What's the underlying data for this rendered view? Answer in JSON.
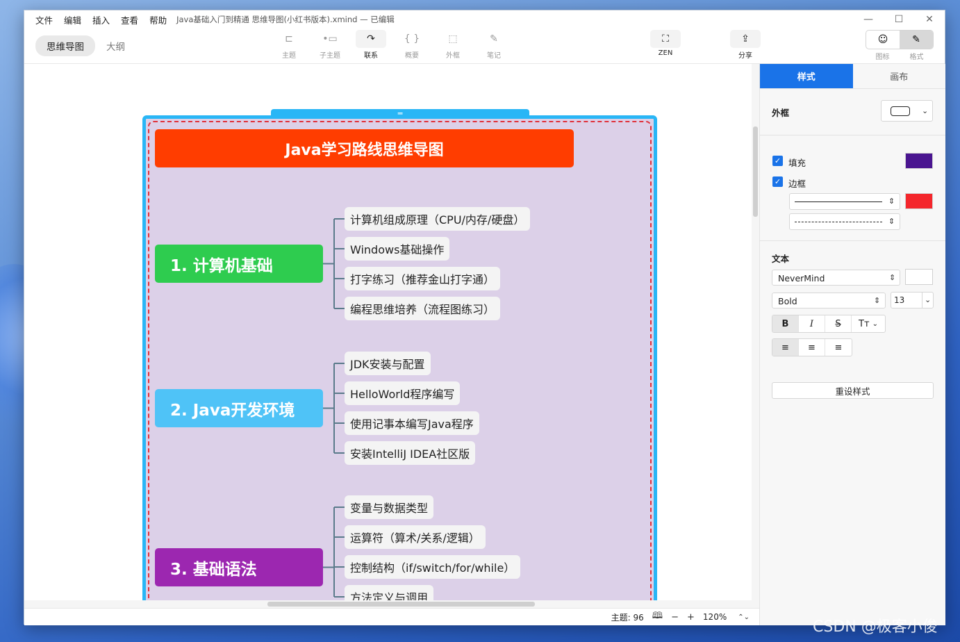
{
  "menu": [
    "文件",
    "编辑",
    "插入",
    "查看",
    "帮助"
  ],
  "doc_title": "Java基础入门到精通 思维导图(小红书版本).xmind — 已编辑",
  "view_tabs": {
    "mindmap": "思维导图",
    "outline": "大纲"
  },
  "tools": [
    {
      "label": "主题",
      "icon": "topic-icon",
      "glyph": "⊏"
    },
    {
      "label": "子主题",
      "icon": "subtopic-icon",
      "glyph": "•▭"
    },
    {
      "label": "联系",
      "icon": "relationship-icon",
      "glyph": "↷"
    },
    {
      "label": "概要",
      "icon": "summary-icon",
      "glyph": "{ }"
    },
    {
      "label": "外框",
      "icon": "boundary-icon",
      "glyph": "⬚"
    },
    {
      "label": "笔记",
      "icon": "note-icon",
      "glyph": "✎"
    }
  ],
  "zen": {
    "label": "ZEN",
    "glyph": "⛶"
  },
  "share": {
    "label": "分享",
    "glyph": "⇪"
  },
  "panel_toggle": {
    "icon_label": "图标",
    "format_label": "格式",
    "icon_glyph": "☺",
    "format_glyph": "✎"
  },
  "map": {
    "title": "Java学习路线思维导图",
    "branches": [
      {
        "label": "1. 计算机基础",
        "color": "#2ecc4f",
        "leaves": [
          "计算机组成原理（CPU/内存/硬盘）",
          "Windows基础操作",
          "打字练习（推荐金山打字通）",
          "编程思维培养（流程图练习）"
        ]
      },
      {
        "label": "2. Java开发环境",
        "color": "#4fc3f7",
        "leaves": [
          "JDK安装与配置",
          "HelloWorld程序编写",
          "使用记事本编写Java程序",
          "安装IntelliJ IDEA社区版"
        ]
      },
      {
        "label": "3. 基础语法",
        "color": "#9c27b0",
        "leaves": [
          "变量与数据类型",
          "运算符（算术/关系/逻辑）",
          "控制结构（if/switch/for/while）",
          "方法定义与调用"
        ]
      }
    ]
  },
  "status": {
    "topics": "主题: 96",
    "zoom": "120%",
    "minus": "−",
    "plus": "+"
  },
  "panel": {
    "tabs": {
      "style": "样式",
      "canvas": "画布"
    },
    "frame_label": "外框",
    "fill_label": "填充",
    "fill_color": "#4a1590",
    "border_label": "边框",
    "border_color": "#f4262c",
    "text_label": "文本",
    "font": "NeverMind",
    "weight": "Bold",
    "size": "13",
    "fmt": {
      "bold": "B",
      "italic": "I",
      "strike": "S",
      "case": "Tт"
    },
    "reset": "重设样式"
  },
  "watermark": "CSDN @极客小俊"
}
